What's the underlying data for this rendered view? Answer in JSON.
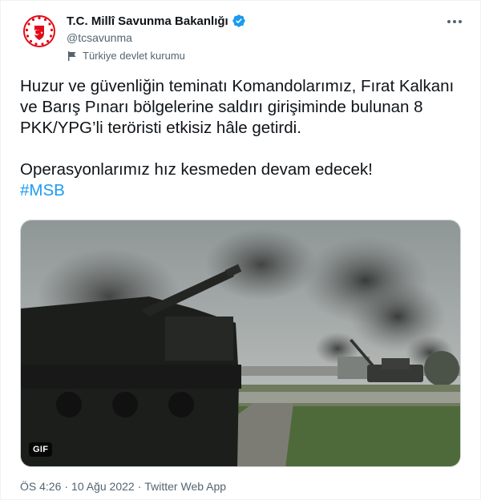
{
  "account": {
    "display_name": "T.C. Millî Savunma Bakanlığı",
    "handle": "@tcsavunma",
    "label": "Türkiye devlet kurumu",
    "verified": true
  },
  "tweet": {
    "text_line_1": "Huzur ve güvenliğin teminatı Komandolarımız, Fırat Kalkanı ve Barış Pınarı bölgelerine saldırı girişiminde bulunan 8 PKK/YPG’li teröristi etkisiz hâle getirdi.",
    "text_line_2": "Operasyonlarımız hız kesmeden devam edecek!",
    "hashtag": "#MSB"
  },
  "media": {
    "badge": "GIF"
  },
  "meta": {
    "time": "ÖS 4:26",
    "separator_1": "·",
    "date": "10 Ağu 2022",
    "separator_2": "·",
    "source": "Twitter Web App"
  },
  "colors": {
    "accent": "#1d9bf0",
    "emblem_red": "#e30a17",
    "secondary_text": "#536471"
  }
}
